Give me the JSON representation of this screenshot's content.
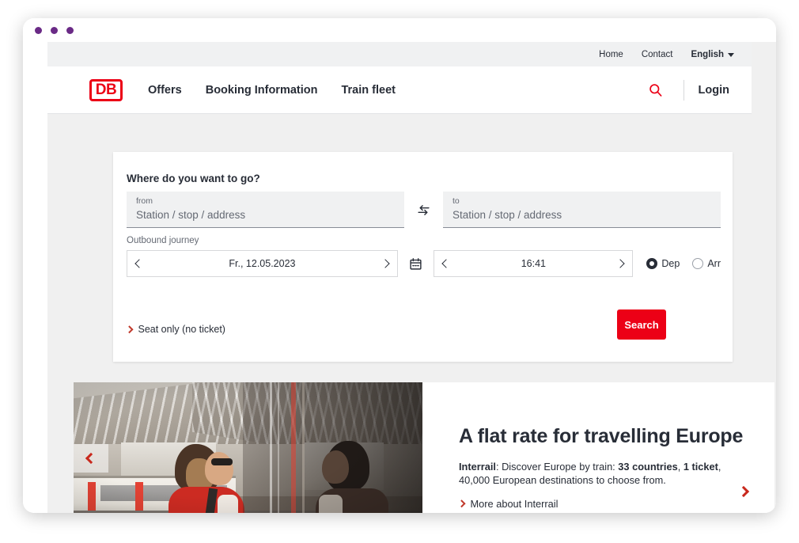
{
  "window": {
    "dot_color": "#6A2A86"
  },
  "utility_nav": {
    "items": [
      {
        "label": "Home"
      },
      {
        "label": "Contact"
      }
    ],
    "language": "English",
    "chevron_icon": "chevron-down-icon"
  },
  "main_nav": {
    "logo_text": "DB",
    "logo_color": "#EC0016",
    "links": [
      {
        "label": "Offers"
      },
      {
        "label": "Booking Information"
      },
      {
        "label": "Train fleet"
      }
    ],
    "search_icon": "search-icon",
    "login_label": "Login"
  },
  "search_card": {
    "title": "Where do you want to go?",
    "from": {
      "label": "from",
      "value": "",
      "placeholder": "Station / stop / address"
    },
    "to": {
      "label": "to",
      "value": "",
      "placeholder": "Station / stop / address"
    },
    "swap_icon": "swap-arrows-icon",
    "outbound_label": "Outbound journey",
    "date": {
      "value": "Fr., 12.05.2023",
      "prev_icon": "chevron-left-icon",
      "next_icon": "chevron-right-icon"
    },
    "calendar_icon": "calendar-icon",
    "time": {
      "value": "16:41",
      "prev_icon": "chevron-left-icon",
      "next_icon": "chevron-right-icon"
    },
    "radios": [
      {
        "label": "Dep",
        "selected": true
      },
      {
        "label": "Arr",
        "selected": false
      }
    ],
    "seat_only": {
      "label": "Seat only (no ticket)",
      "icon": "chevron-right-icon"
    },
    "search_button": {
      "label": "Search",
      "color": "#EC0016"
    }
  },
  "promo": {
    "heading": "A flat rate for travelling Europe",
    "body_brand": "Interrail",
    "body_part1": ": Discover Europe by train: ",
    "body_bold1": "33 countries",
    "body_part2": ", ",
    "body_bold2": "1 ticket",
    "body_part3": ", 40,000 European destinations to choose from.",
    "link_label": "More about Interrail",
    "prev_icon": "chevron-left-icon",
    "next_icon": "chevron-right-icon",
    "image_alt": "woman at train station looking at reflection"
  }
}
